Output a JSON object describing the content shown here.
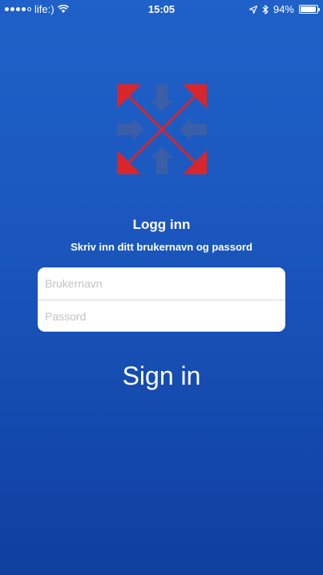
{
  "status_bar": {
    "carrier": "life:)",
    "time": "15:05",
    "battery_percent": "94%",
    "battery_level": 0.94,
    "icons": [
      "signal-dots-icon",
      "wifi-icon",
      "location-arrow-icon",
      "bluetooth-icon",
      "battery-icon"
    ]
  },
  "logo": {
    "icon": "expand-arrows-logo",
    "colors": {
      "red": "#d9262b",
      "blue": "#3a5fa8"
    }
  },
  "login": {
    "title": "Logg inn",
    "subtitle": "Skriv inn ditt brukernavn og passord",
    "username_placeholder": "Brukernavn",
    "username_value": "",
    "password_placeholder": "Passord",
    "password_value": "",
    "sign_in_label": "Sign in"
  },
  "colors": {
    "background_top": "#1f61c8",
    "background_bottom": "#0f3f9f",
    "text": "#ffffff"
  }
}
